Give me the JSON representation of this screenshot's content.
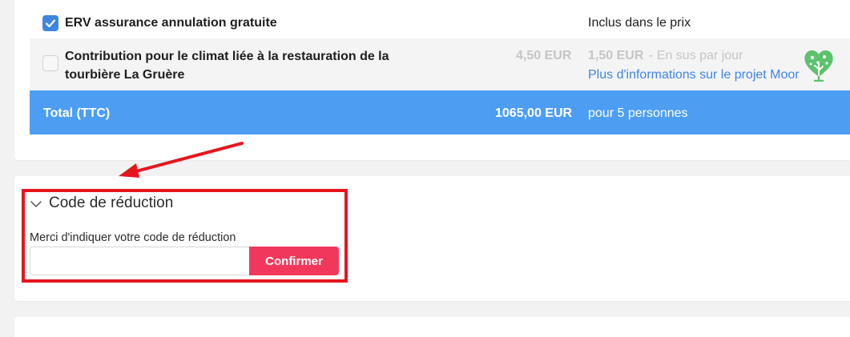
{
  "options_table": {
    "erv_row": {
      "checked": true,
      "label": "ERV assurance annulation gratuite",
      "price_info": "Inclus dans le prix"
    },
    "climate_row": {
      "checked": false,
      "label_line1": "Contribution pour le climat liée à la restauration de la",
      "label_line2": "tourbière La Gruère",
      "price": "4,50 EUR",
      "day_price": "1,50 EUR",
      "day_note": " - En sus par jour",
      "link": "Plus d'informations sur le projet Moor",
      "icon": "tree-heart-icon"
    },
    "total_row": {
      "label": "Total (TTC)",
      "price": "1065,00 EUR",
      "note": "pour 5 personnes"
    }
  },
  "discount": {
    "title": "Code de réduction",
    "instruction": "Merci d'indiquer votre code de réduction",
    "input_value": "",
    "input_placeholder": "",
    "confirm_label": "Confirmer"
  },
  "colors": {
    "total_bg": "#4d9ef2",
    "confirm_bg": "#f2385a",
    "checkbox_checked": "#3d86e0",
    "link": "#3d86e0",
    "annotation_red": "#e8141c",
    "tree_green": "#5cc26b"
  }
}
